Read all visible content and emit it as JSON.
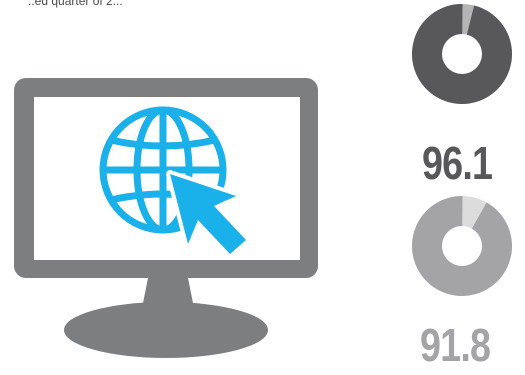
{
  "header": {
    "partial_text": "..ed quarter of 2..."
  },
  "stats": [
    {
      "value": "96.1",
      "fraction": 0.961,
      "color": "#58585a",
      "remainder_color": "#b5b5b6"
    },
    {
      "value": "91.8",
      "fraction": 0.918,
      "color": "#a4a4a6",
      "remainder_color": "#dcdcdd"
    }
  ],
  "colors": {
    "monitor": "#7d7e80",
    "screen": "#ffffff",
    "globe": "#1ab0ea"
  },
  "icons": {
    "monitor": "monitor-icon",
    "globe": "globe-icon",
    "cursor": "cursor-arrow-icon"
  }
}
